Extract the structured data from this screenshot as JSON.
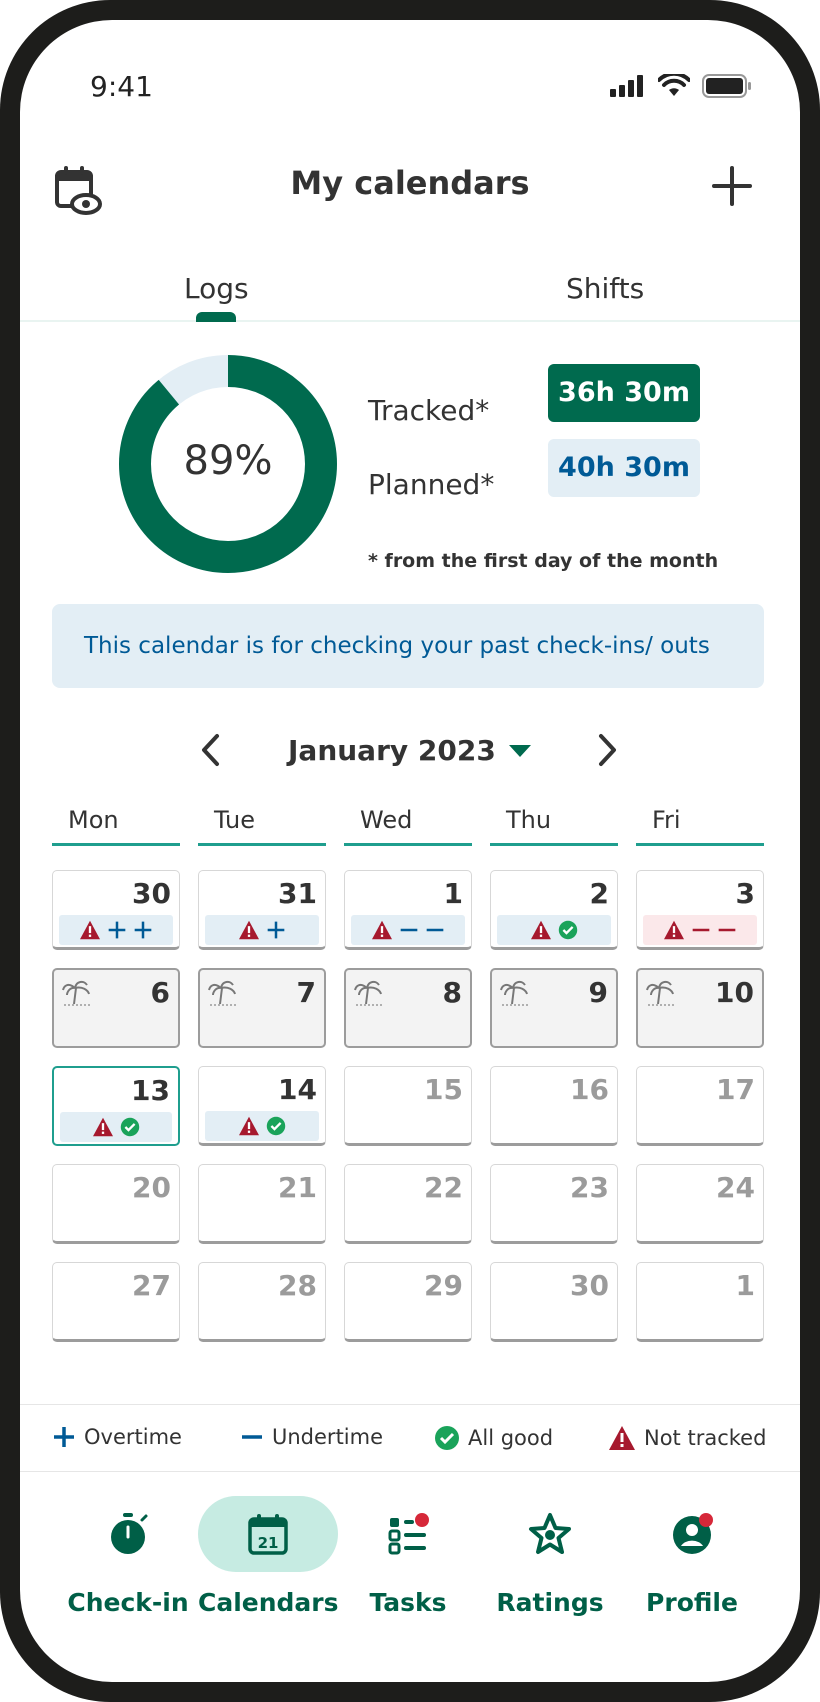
{
  "status_bar": {
    "time": "9:41"
  },
  "header": {
    "title": "My calendars",
    "left_icon": "calendar-eye-icon",
    "right_icon": "plus-icon"
  },
  "tabs": [
    {
      "label": "Logs",
      "active": true
    },
    {
      "label": "Shifts",
      "active": false
    }
  ],
  "summary": {
    "percent": 89,
    "percent_label": "89%",
    "tracked_label": "Tracked*",
    "tracked_value": "36h 30m",
    "planned_label": "Planned*",
    "planned_value": "40h 30m",
    "footnote": "* from the first day of the month"
  },
  "info_message": "This calendar is for checking your past check-ins/ outs",
  "month_nav": {
    "title": "January 2023"
  },
  "weekdays": [
    "Mon",
    "Tue",
    "Wed",
    "Thu",
    "Fri"
  ],
  "weeks": [
    [
      {
        "day": "30",
        "state": "past",
        "marks": [
          "warning",
          "plus",
          "plus"
        ]
      },
      {
        "day": "31",
        "state": "past",
        "marks": [
          "warning",
          "plus"
        ]
      },
      {
        "day": "1",
        "state": "past",
        "marks": [
          "warning",
          "minus",
          "minus"
        ]
      },
      {
        "day": "2",
        "state": "past",
        "marks": [
          "warning",
          "check"
        ]
      },
      {
        "day": "3",
        "state": "past",
        "marks": [
          "warning",
          "minus",
          "minus"
        ],
        "alert": true
      }
    ],
    [
      {
        "day": "6",
        "state": "holiday",
        "marks": []
      },
      {
        "day": "7",
        "state": "holiday",
        "marks": []
      },
      {
        "day": "8",
        "state": "holiday",
        "marks": []
      },
      {
        "day": "9",
        "state": "holiday",
        "marks": []
      },
      {
        "day": "10",
        "state": "holiday",
        "marks": []
      }
    ],
    [
      {
        "day": "13",
        "state": "today",
        "marks": [
          "warning",
          "check"
        ]
      },
      {
        "day": "14",
        "state": "past",
        "marks": [
          "warning",
          "check"
        ]
      },
      {
        "day": "15",
        "state": "future",
        "marks": []
      },
      {
        "day": "16",
        "state": "future",
        "marks": []
      },
      {
        "day": "17",
        "state": "future",
        "marks": []
      }
    ],
    [
      {
        "day": "20",
        "state": "future",
        "marks": []
      },
      {
        "day": "21",
        "state": "future",
        "marks": []
      },
      {
        "day": "22",
        "state": "future",
        "marks": []
      },
      {
        "day": "23",
        "state": "future",
        "marks": []
      },
      {
        "day": "24",
        "state": "future",
        "marks": []
      }
    ],
    [
      {
        "day": "27",
        "state": "future",
        "marks": []
      },
      {
        "day": "28",
        "state": "future",
        "marks": []
      },
      {
        "day": "29",
        "state": "future",
        "marks": []
      },
      {
        "day": "30",
        "state": "future",
        "marks": []
      },
      {
        "day": "1",
        "state": "future",
        "marks": []
      }
    ]
  ],
  "legend": [
    {
      "icon": "plus",
      "label": "Overtime"
    },
    {
      "icon": "minus",
      "label": "Undertime"
    },
    {
      "icon": "check",
      "label": "All good"
    },
    {
      "icon": "warning",
      "label": "Not tracked"
    }
  ],
  "bottom_nav": [
    {
      "label": "Check-in",
      "icon": "stopwatch-icon",
      "active": false,
      "badge": false
    },
    {
      "label": "Calendars",
      "icon": "calendar-icon",
      "active": true,
      "badge": false,
      "icon_text": "21"
    },
    {
      "label": "Tasks",
      "icon": "task-list-icon",
      "active": false,
      "badge": true
    },
    {
      "label": "Ratings",
      "icon": "star-icon",
      "active": false,
      "badge": false
    },
    {
      "label": "Profile",
      "icon": "profile-icon",
      "active": false,
      "badge": true
    }
  ],
  "colors": {
    "primary": "#006a4e",
    "primary_light": "#c6ebe2",
    "info_bg": "#e3eef5",
    "info_text": "#005a96",
    "alert_red": "#a6192e",
    "check_green": "#1aa35a",
    "teal_line": "#1f9e8e"
  }
}
